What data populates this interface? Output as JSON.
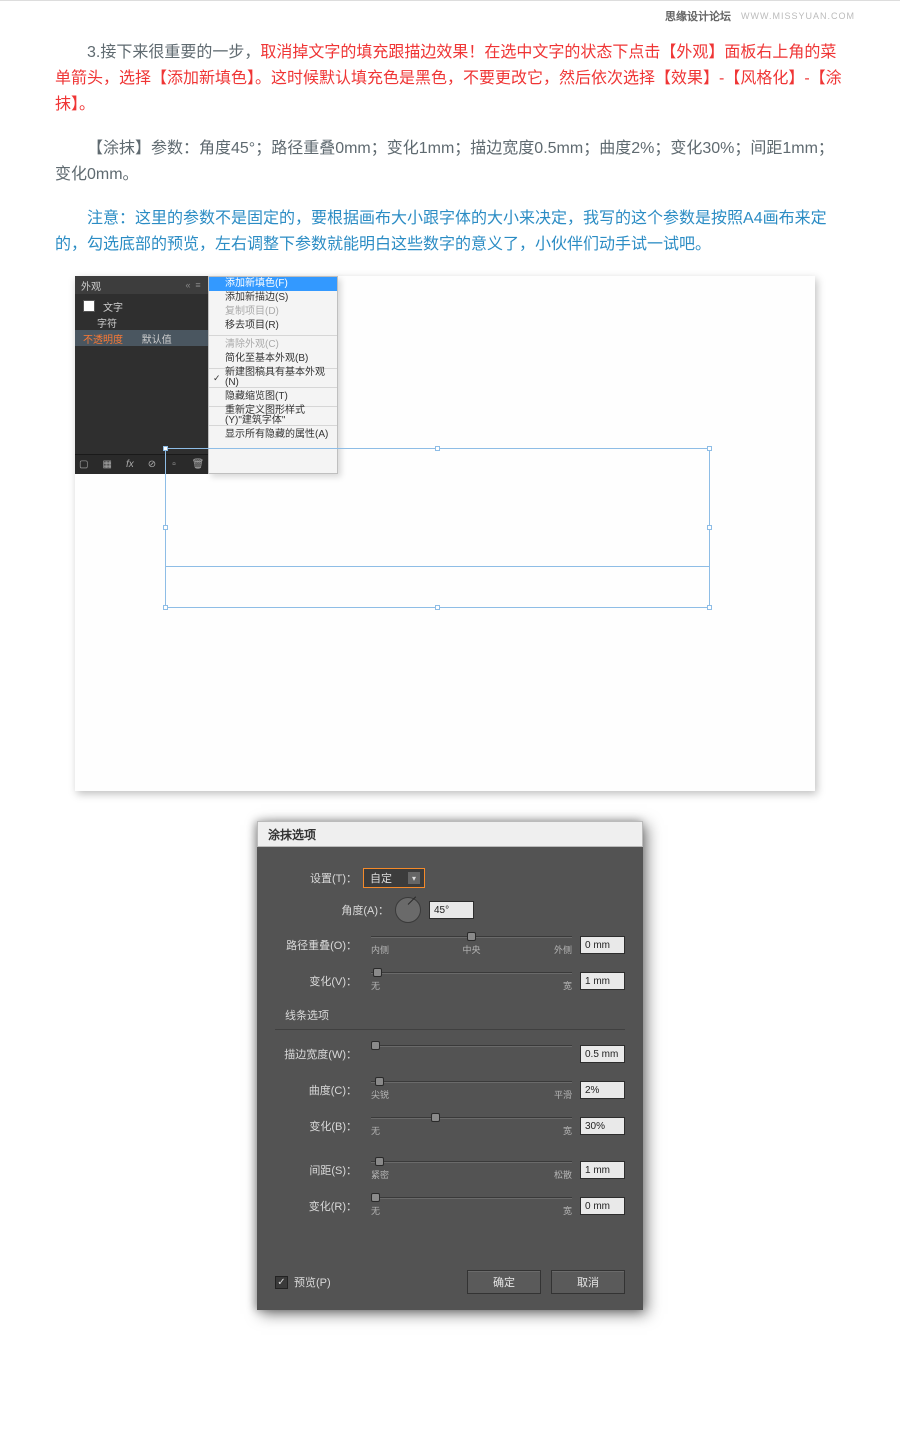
{
  "header": {
    "site": "思缘设计论坛",
    "url": "WWW.MISSYUAN.COM"
  },
  "para1_pre": "3.接下来很重要的一步，",
  "para1_red": "取消掉文字的填充跟描边效果！在选中文字的状态下点击【外观】面板右上角的菜单箭头，选择【添加新填色】。这时候默认填充色是黑色，不要更改它，然后依次选择【效果】-【风格化】-【涂抹】。",
  "para2": "【涂抹】参数：角度45°；路径重叠0mm；变化1mm；描边宽度0.5mm；曲度2%；变化30%；间距1mm；变化0mm。",
  "para3_pre": "注意：",
  "para3_blue": "这里的参数不是固定的，要根据画布大小跟字体的大小来决定，我写的这个参数是按照A4画布来定的，勾选底部的预览，左右调整下参数就能明白这些数字的意义了，小伙伴们动手试一试吧。",
  "appearance": {
    "title": "外观",
    "rows": {
      "text": "文字",
      "char": "字符",
      "opacity": "不透明度",
      "default": "默认值"
    }
  },
  "menu": {
    "addFill": "添加新填色(F)",
    "addStroke": "添加新描边(S)",
    "dupItem": "复制项目(D)",
    "removeItem": "移去项目(R)",
    "clearAppear": "清除外观(C)",
    "reduceBasic": "简化至基本外观(B)",
    "newHasBasic": "新建图稿具有基本外观(N)",
    "hideThumb": "隐藏缩览图(T)",
    "redefineStyle": "重新定义图形样式(Y)\"建筑字体\"",
    "showAllHidden": "显示所有隐藏的属性(A)"
  },
  "dialog": {
    "title": "涂抹选项",
    "settings": "设置(T)：",
    "settingsVal": "自定",
    "angle": "角度(A)：",
    "angleVal": "45°",
    "pathOverlap": "路径重叠(O)：",
    "pathOverlapVal": "0 mm",
    "labInner": "内侧",
    "labCenter": "中央",
    "labOuter": "外侧",
    "variation": "变化(V)：",
    "variationVal": "1 mm",
    "labNone": "无",
    "labWide": "宽",
    "lineSec": "线条选项",
    "strokeW": "描边宽度(W)：",
    "strokeWVal": "0.5 mm",
    "curv": "曲度(C)：",
    "curvVal": "2%",
    "labSharp": "尖锐",
    "labSmooth": "平滑",
    "variationB": "变化(B)：",
    "variationBVal": "30%",
    "spacing": "间距(S)：",
    "spacingVal": "1 mm",
    "labTight": "紧密",
    "labLoose": "松散",
    "variationR": "变化(R)：",
    "variationRVal": "0 mm",
    "preview": "预览(P)",
    "ok": "确定",
    "cancel": "取消"
  }
}
